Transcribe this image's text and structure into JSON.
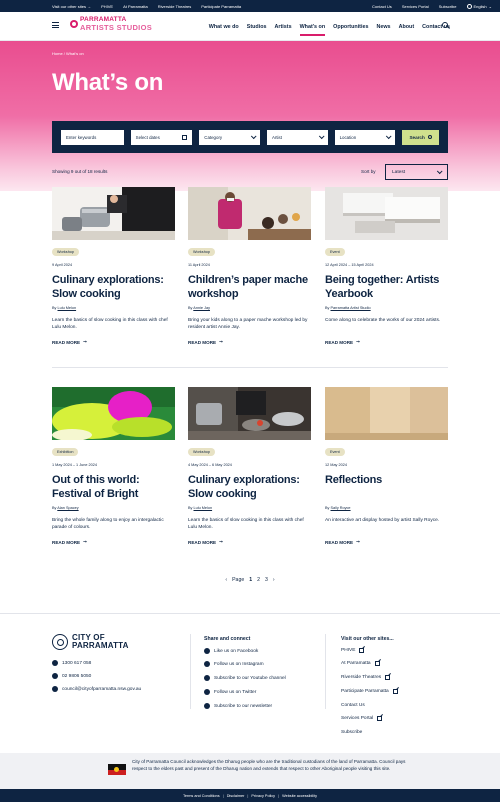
{
  "utility": {
    "left": [
      "Visit our other sites →",
      "PHIVE",
      "At Parramatta",
      "Riverside Theatres",
      "Participate Parramatta"
    ],
    "right": [
      "Contact Us",
      "Services Portal",
      "Subscribe"
    ],
    "language": "English"
  },
  "header": {
    "logo_top": "PARRAMATTA",
    "logo_bottom": "ARTISTS STUDIOS",
    "nav": [
      "What we do",
      "Studios",
      "Artists",
      "What's on",
      "Opportunities",
      "News",
      "About",
      "Contact us"
    ],
    "active": "What's on"
  },
  "hero": {
    "breadcrumb": "Home  /  What's on",
    "title": "What’s on"
  },
  "filters": {
    "keywords_placeholder": "Enter keywords",
    "dates_placeholder": "Select dates",
    "category": "Category",
    "artist": "Artist",
    "location": "Location",
    "search_label": "Search"
  },
  "results": {
    "count_text": "Showing 9 out of 18 results",
    "sort_label": "Sort by",
    "sort_value": "Latest"
  },
  "cards": [
    {
      "tag": "Workshop",
      "date": "9 April 2024",
      "title": "Culinary explorations: Slow cooking",
      "by_prefix": "By",
      "by": "Lulu Melon",
      "desc": "Learn the basics of slow cooking in this class with chef Lulu Melon.",
      "more": "READ MORE"
    },
    {
      "tag": "Workshop",
      "date": "11 April 2024",
      "title": "Children’s paper mache workshop",
      "by_prefix": "By",
      "by": "Annie Jay",
      "desc": "Bring your kids along to a paper mache workshop led by resident artist Annie Jay.",
      "more": "READ MORE"
    },
    {
      "tag": "Event",
      "date": "12 April 2024 – 15 April 2024",
      "title": "Being together: Artists Yearbook",
      "by_prefix": "By",
      "by": "Parramatta Artist Studio",
      "desc": "Come along to celebrate the works of our 2024 artists.",
      "more": "READ MORE"
    },
    {
      "tag": "Exhibition",
      "date": "1 May 2024 – 1 June 2024",
      "title": "Out of this world: Festival of Bright",
      "by_prefix": "By",
      "by": "Alan Spacey",
      "desc": "Bring the whole family along to enjoy an intergalactic parade of colours.",
      "more": "READ MORE"
    },
    {
      "tag": "Workshop",
      "date": "4 May 2024 – 6 May 2024",
      "title": "Culinary explorations: Slow cooking",
      "by_prefix": "By",
      "by": "Lulu Melon",
      "desc": "Learn the basics of slow cooking in this class with chef Lulu Melon.",
      "more": "READ MORE"
    },
    {
      "tag": "Event",
      "date": "12 May 2024",
      "title": "Reflections",
      "by_prefix": "By",
      "by": "Sally Royce",
      "desc": "An interactive art display hosted by artist Sally Royce.",
      "more": "READ MORE"
    }
  ],
  "pagination": {
    "label": "Page",
    "pages": [
      "1",
      "2",
      "3"
    ],
    "current": "1"
  },
  "footer": {
    "logo_line1": "CITY OF",
    "logo_line2": "PARRAMATTA",
    "phone1": "1300 617 058",
    "phone2": "02 9806 5050",
    "email": "council@cityofparramatta.nsw.gov.au",
    "share_heading": "Share and connect",
    "share": [
      "Like us on Facebook",
      "Follow us on Instagram",
      "Subscribe to our Youtube channel",
      "Follow us on Twitter",
      "Subscribe to our newsletter"
    ],
    "visit_heading": "Visit our other sites...",
    "visit": [
      "PHIVE",
      "At Parramatta",
      "Riverside Theatres",
      "Participate Parramatta",
      "Contact Us",
      "Services Portal",
      "Subscribe"
    ]
  },
  "acknowledgement": "City of Parramatta Council acknowledges the Dharug people who are the traditional custodians of the land of Parramatta. Council pays respect to the elders past and present of the Dharug nation and extends that respect to other Aboriginal people visiting this site.",
  "bottom_links": [
    "Terms and Conditions",
    "Disclaimer",
    "Privacy Policy",
    "Website accessibility"
  ],
  "colors": {
    "navy": "#0e2442",
    "pink": "#d91d6b",
    "lime": "#cfe08d",
    "tag": "#e7e2c4"
  }
}
